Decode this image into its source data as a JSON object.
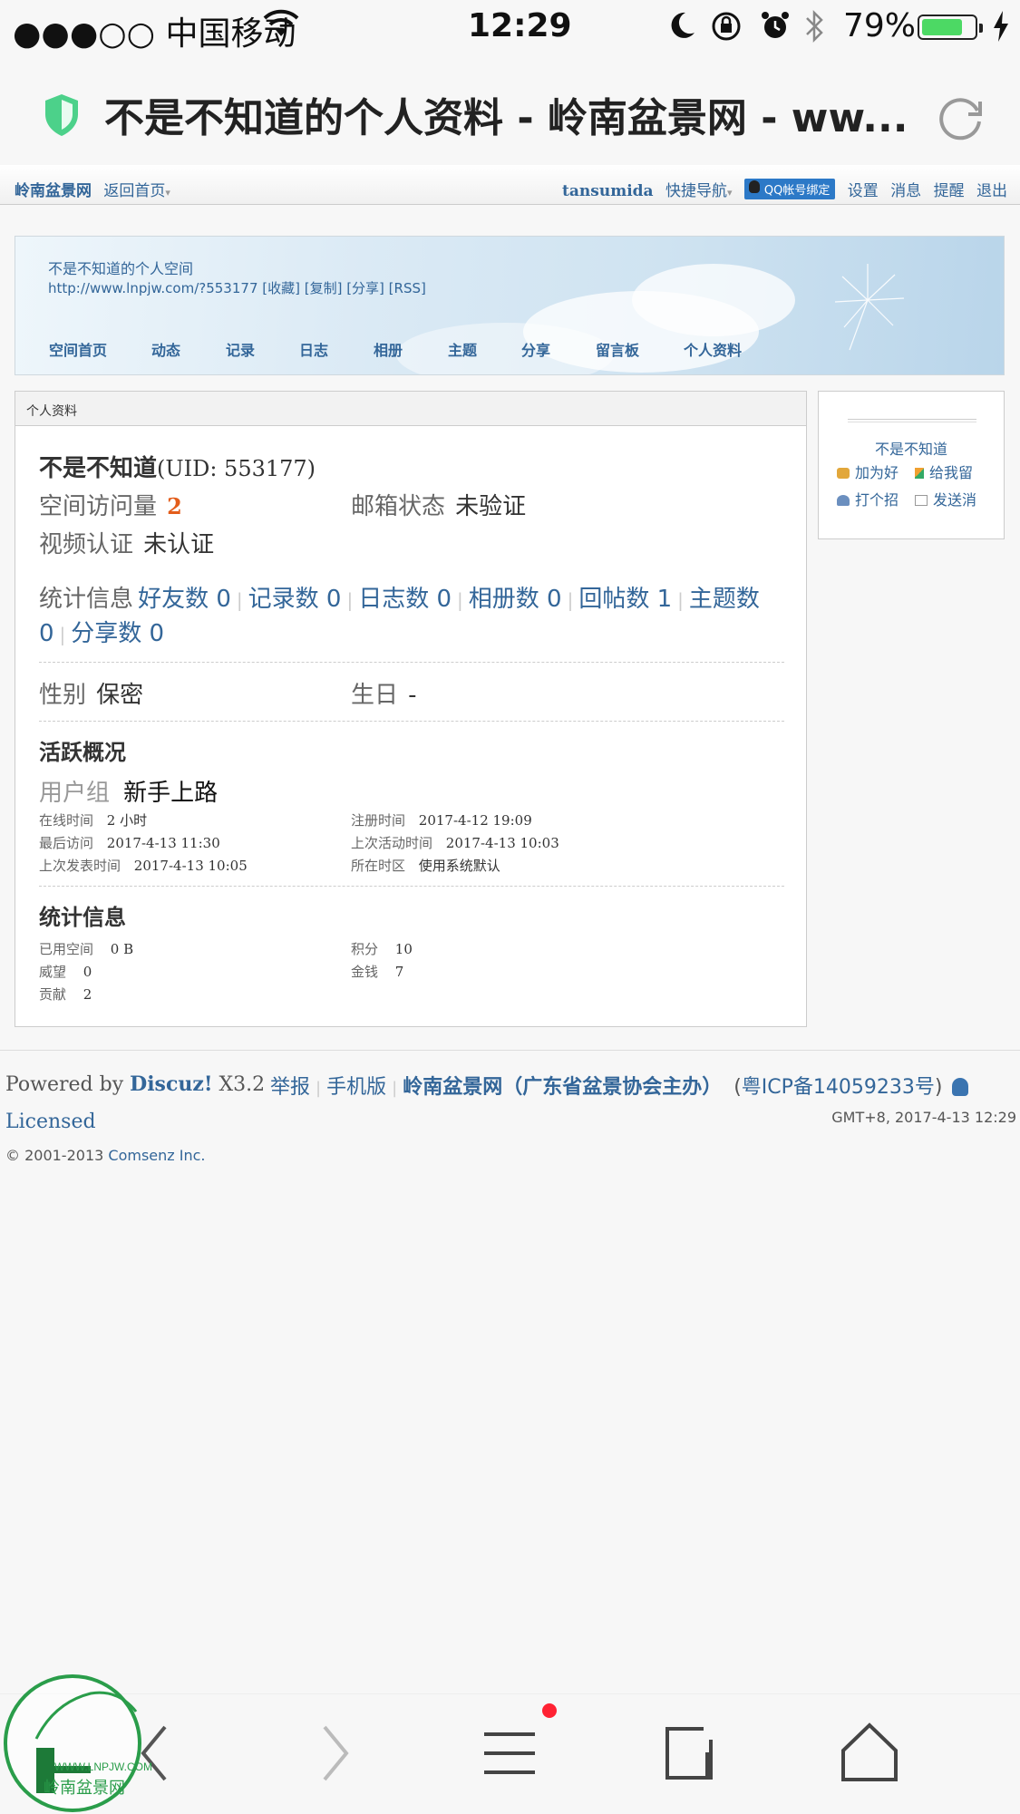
{
  "status_bar": {
    "carrier": "●●●○○ 中国移动",
    "time": "12:29",
    "battery_percent": "79%",
    "battery_level": 0.79
  },
  "browser": {
    "page_title": "不是不知道的个人资料 - 岭南盆景网 - ww..."
  },
  "toolbar": {
    "site_name": "岭南盆景网",
    "home_link": "返回首页",
    "username": "tansumida",
    "quick_nav": "快捷导航",
    "qq_bind": "QQ帐号绑定",
    "settings": "设置",
    "messages": "消息",
    "reminders": "提醒",
    "logout": "退出"
  },
  "banner": {
    "space_name": "不是不知道的个人空间",
    "space_url": "http://www.lnpjw.com/?553177 [收藏] [复制] [分享] [RSS]",
    "nav": [
      "空间首页",
      "动态",
      "记录",
      "日志",
      "相册",
      "主题",
      "分享",
      "留言板",
      "个人资料"
    ]
  },
  "profile": {
    "header": "个人资料",
    "name": "不是不知道",
    "uid": "(UID: 553177)",
    "visits_label": "空间访问量",
    "visits_value": "2",
    "email_label": "邮箱状态",
    "email_value": "未验证",
    "video_label": "视频认证",
    "video_value": "未认证",
    "stats_label": "统计信息",
    "stats": {
      "friends": "好友数 0",
      "records": "记录数 0",
      "blogs": "日志数 0",
      "albums": "相册数 0",
      "replies": "回帖数 1",
      "threads_a": "主题数",
      "threads_b": "0",
      "shares": "分享数 0"
    },
    "gender_label": "性别",
    "gender_value": "保密",
    "birthday_label": "生日",
    "birthday_value": "-",
    "activity_title": "活跃概况",
    "group_label": "用户组",
    "group_value": "新手上路",
    "online_label": "在线时间",
    "online_value": "2 小时",
    "register_label": "注册时间",
    "register_value": "2017-4-12 19:09",
    "last_visit_label": "最后访问",
    "last_visit_value": "2017-4-13 11:30",
    "last_active_label": "上次活动时间",
    "last_active_value": "2017-4-13 10:03",
    "last_post_label": "上次发表时间",
    "last_post_value": "2017-4-13 10:05",
    "timezone_label": "所在时区",
    "timezone_value": "使用系统默认",
    "stats2_title": "统计信息",
    "space_used_label": "已用空间",
    "space_used_value": "0 B",
    "points_label": "积分",
    "points_value": "10",
    "prestige_label": "威望",
    "prestige_value": "0",
    "money_label": "金钱",
    "money_value": "7",
    "contribution_label": "贡献",
    "contribution_value": "2"
  },
  "side_card": {
    "name": "不是不知道",
    "add_friend": "加为好",
    "leave_msg": "给我留",
    "poke": "打个招",
    "send_msg": "发送消"
  },
  "footer": {
    "powered_by": "Powered by ",
    "discuz": "Discuz!",
    "version": " X3.2",
    "licensed": "Licensed",
    "copyright_prefix": "© 2001-2013 ",
    "comsenz": "Comsenz Inc.",
    "report": "举报",
    "mobile": "手机版",
    "site_full": "岭南盆景网（广东省盆景协会主办）",
    "icp": "粤ICP备14059233号",
    "gmt": "GMT+8, 2017-4-13 12:29"
  },
  "watermark": {
    "text": "WWW.LNPJW.COM",
    "cn": "岭南盆景网"
  }
}
